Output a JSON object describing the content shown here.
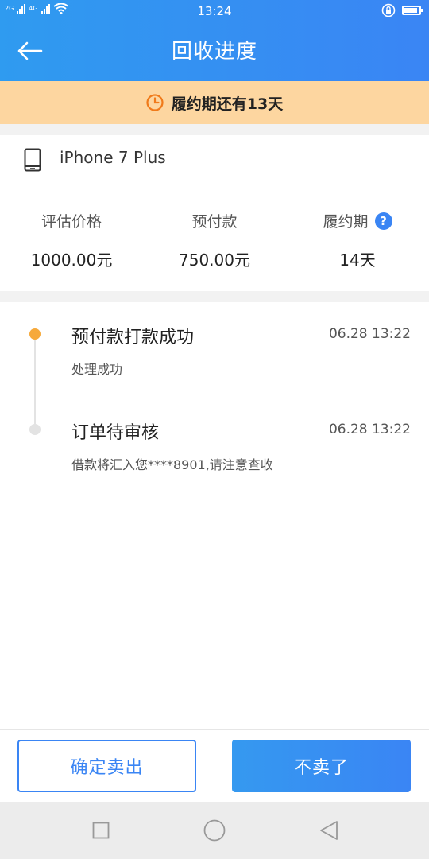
{
  "status_bar": {
    "network_1": "2G",
    "network_2": "4G",
    "time": "13:24",
    "icons": [
      "signal-icon",
      "wifi-icon",
      "lock-rotation-icon",
      "battery-icon"
    ],
    "battery_level": 0.9
  },
  "header": {
    "title": "回收进度",
    "back_icon": "back-arrow-icon"
  },
  "banner": {
    "text": "履约期还有13天",
    "icon": "clock-icon",
    "color": "#fdd6a0"
  },
  "product": {
    "icon": "phone-icon",
    "name": "iPhone 7 Plus",
    "stats": [
      {
        "label": "评估价格",
        "value": "1000.00元"
      },
      {
        "label": "预付款",
        "value": "750.00元"
      },
      {
        "label": "履约期",
        "value": "14天",
        "help_icon": "question-icon"
      }
    ]
  },
  "timeline": [
    {
      "title": "预付款打款成功",
      "time": "06.28 13:22",
      "desc": "处理成功",
      "active": true
    },
    {
      "title": "订单待审核",
      "time": "06.28 13:22",
      "desc": "借款将汇入您****8901,请注意查收",
      "active": false
    }
  ],
  "actions": {
    "confirm_label": "确定卖出",
    "cancel_label": "不卖了"
  },
  "nav": {
    "items": [
      "square-icon",
      "circle-icon",
      "triangle-back-icon"
    ]
  },
  "colors": {
    "accent": "#3a85f4",
    "banner": "#fdd6a0",
    "active_dot": "#f6a93b",
    "inactive_dot": "#e3e3e3"
  }
}
